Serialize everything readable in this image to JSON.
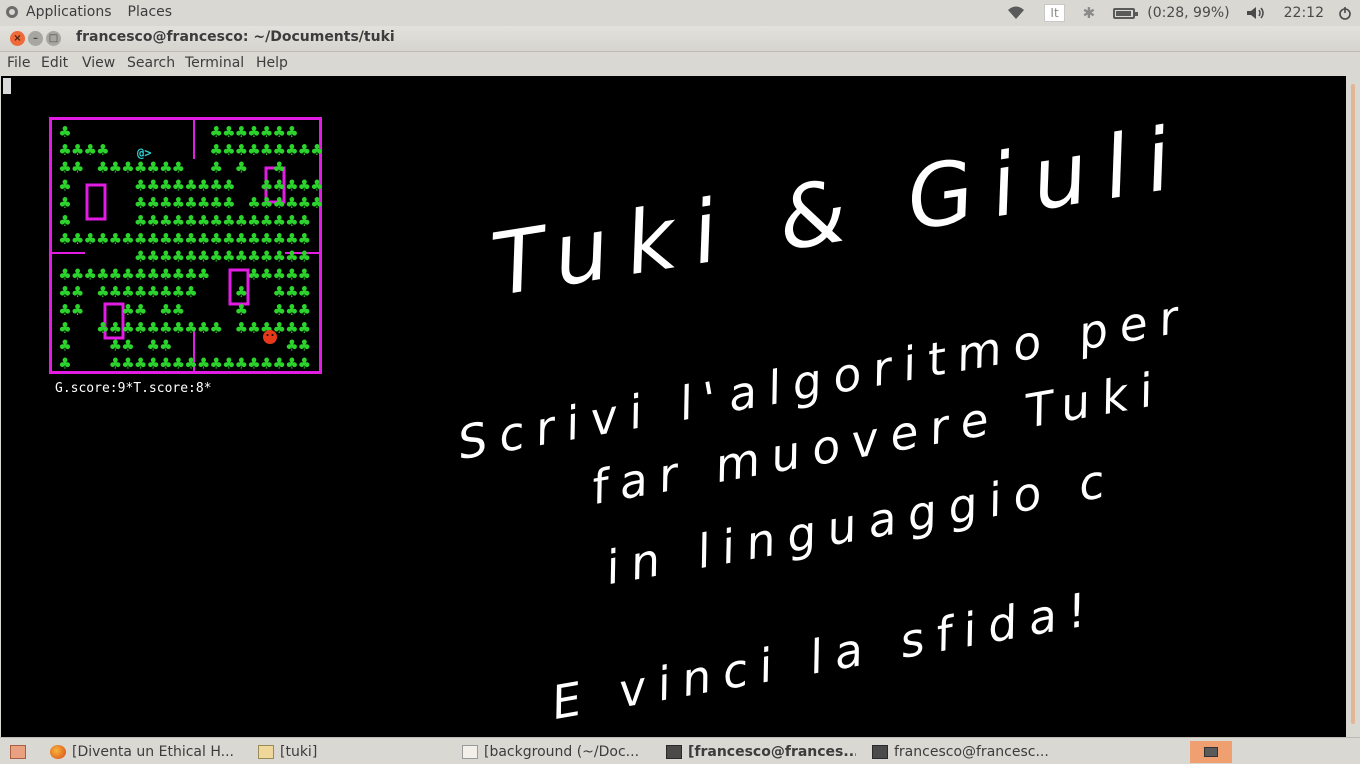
{
  "top_panel": {
    "applications": "Applications",
    "places": "Places",
    "keyboard_layout": "It",
    "battery": "(0:28, 99%)",
    "clock": "22:12",
    "icons": [
      "wifi-icon",
      "bluetooth-icon",
      "battery-icon",
      "volume-icon"
    ]
  },
  "window": {
    "title": "francesco@francesco: ~/Documents/tuki",
    "menu": [
      "File",
      "Edit",
      "View",
      "Search",
      "Terminal",
      "Help"
    ]
  },
  "game": {
    "score": "G.score:9*T.score:8*",
    "player_glyph": "@>",
    "colors": {
      "walls": "#e31ce3",
      "clover": "#2cd32c",
      "player": "#2dd3d3",
      "enemy": "#e5391a"
    }
  },
  "poster": {
    "title": "Tuki & Giuli",
    "line1": "Scrivi l'algoritmo per",
    "line2": "far muovere Tuki",
    "line3": "in linguaggio c",
    "line4": "E vinci la sfida!"
  },
  "taskbar": {
    "items": [
      "[Diventa un Ethical H...",
      "[tuki]",
      "[background (~/Doc...",
      "[francesco@frances...",
      "francesco@francesc..."
    ]
  }
}
